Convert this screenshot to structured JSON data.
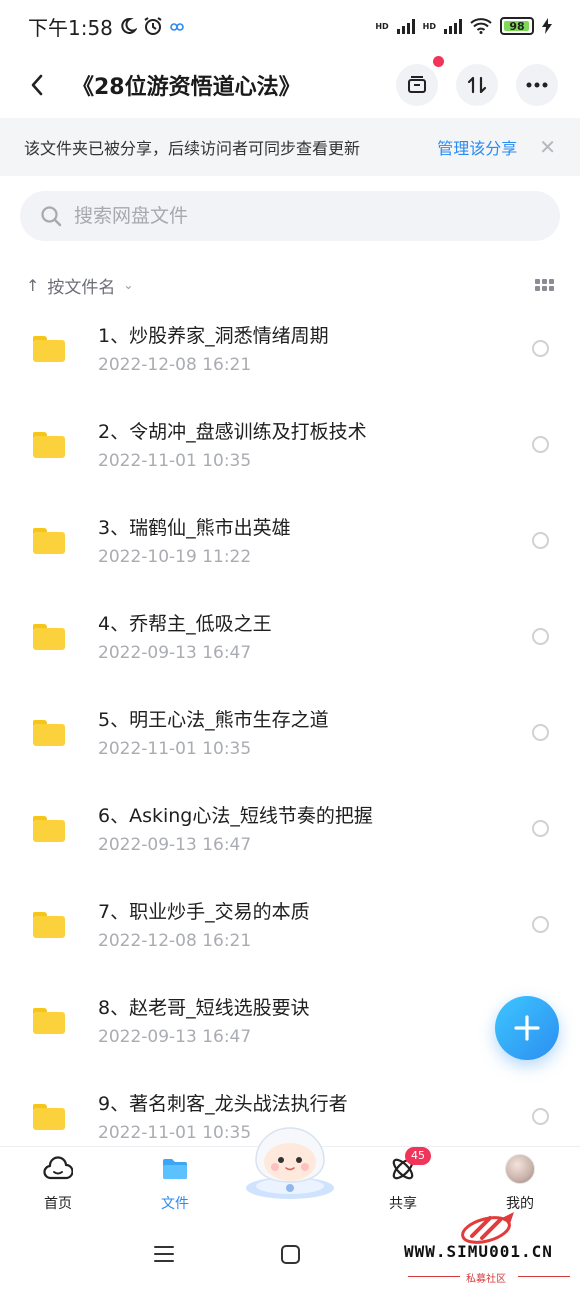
{
  "status_bar": {
    "time": "下午1:58",
    "battery": "98",
    "network_1": "HD",
    "network_2": "HD"
  },
  "header": {
    "title": "《28位游资悟道心法》"
  },
  "share_banner": {
    "message": "该文件夹已被分享，后续访问者可同步查看更新",
    "manage_link": "管理该分享"
  },
  "search": {
    "placeholder": "搜索网盘文件"
  },
  "sort": {
    "label": "按文件名"
  },
  "files": [
    {
      "name": "1、炒股养家_洞悉情绪周期",
      "date": "2022-12-08  16:21"
    },
    {
      "name": "2、令胡冲_盘感训练及打板技术",
      "date": "2022-11-01  10:35"
    },
    {
      "name": "3、瑞鹤仙_熊市出英雄",
      "date": "2022-10-19  11:22"
    },
    {
      "name": "4、乔帮主_低吸之王",
      "date": "2022-09-13  16:47"
    },
    {
      "name": "5、明王心法_熊市生存之道",
      "date": "2022-11-01  10:35"
    },
    {
      "name": "6、Asking心法_短线节奏的把握",
      "date": "2022-09-13  16:47"
    },
    {
      "name": "7、职业炒手_交易的本质",
      "date": "2022-12-08  16:21"
    },
    {
      "name": "8、赵老哥_短线选股要诀",
      "date": "2022-09-13  16:47"
    },
    {
      "name": "9、著名刺客_龙头战法执行者",
      "date": "2022-11-01  10:35"
    }
  ],
  "tabs": [
    {
      "label": "首页",
      "icon": "cloud-icon"
    },
    {
      "label": "文件",
      "icon": "folder-icon"
    },
    {
      "label": "共享",
      "icon": "atom-icon",
      "badge": "45"
    },
    {
      "label": "我的",
      "icon": "avatar"
    }
  ],
  "watermark": {
    "text": "WWW.SIMU001.CN",
    "subtext": "私募社区"
  },
  "colors": {
    "accent": "#2a8bf2",
    "folder": "#fbd23b",
    "badge": "#f0345a"
  }
}
